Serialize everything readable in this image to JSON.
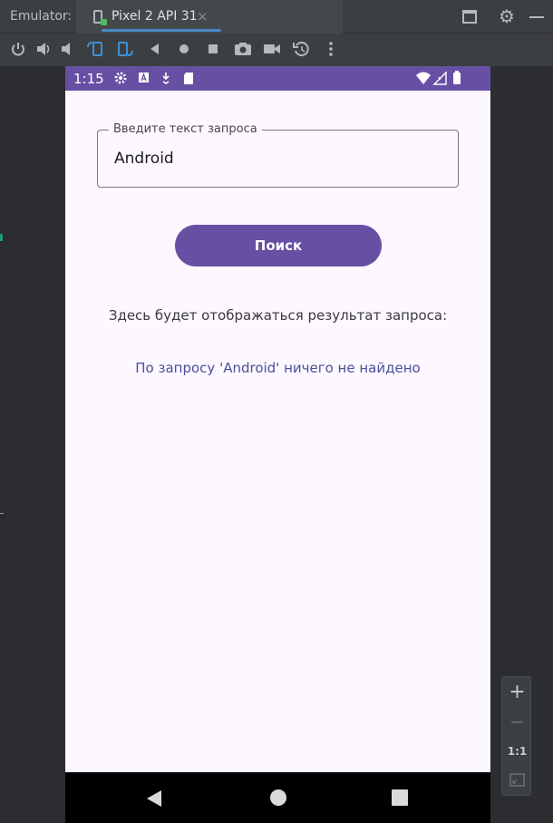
{
  "titlebar": {
    "emulator_label": "Emulator:",
    "tab_label": "Pixel 2 API 31",
    "tab_close": "×"
  },
  "toolbar": {
    "icons": [
      "power-icon",
      "volume-up-icon",
      "volume-down-icon",
      "rotate-left-icon",
      "rotate-right-icon",
      "back-icon",
      "home-icon",
      "overview-icon",
      "camera-icon",
      "video-icon",
      "snapshot-icon",
      "more-icon"
    ]
  },
  "phone": {
    "status": {
      "time": "1:15"
    },
    "search": {
      "label": "Введите текст запроса",
      "value": "Android",
      "button_label": "Поиск"
    },
    "result": {
      "caption": "Здесь будет отображаться результат запроса:",
      "text": "По запросу 'Android' ничего не найдено"
    }
  },
  "zoom": {
    "plus": "+",
    "minus": "−",
    "one_to_one": "1:1"
  },
  "colors": {
    "accent": "#6750a4",
    "screen_background": "#fdf7ff",
    "result_text": "#4b4f9a"
  }
}
